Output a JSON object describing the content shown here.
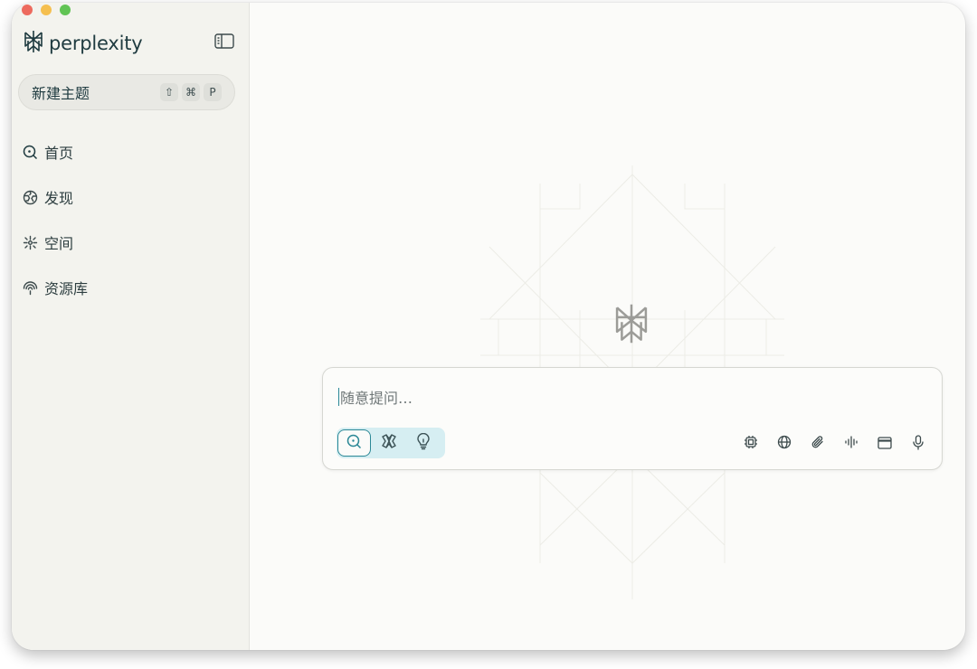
{
  "window": {
    "traffic_colors": [
      "#ed6a5e",
      "#f5bf4f",
      "#61c454"
    ]
  },
  "sidebar": {
    "brand": "perplexity",
    "collapse_icon": "sidebar-toggle-icon",
    "new_thread": {
      "label": "新建主题",
      "shortcut": [
        "⇧",
        "⌘",
        "P"
      ]
    },
    "items": [
      {
        "label": "首页",
        "icon": "search-home-icon"
      },
      {
        "label": "发现",
        "icon": "globe-icon"
      },
      {
        "label": "空间",
        "icon": "spaces-icon"
      },
      {
        "label": "资源库",
        "icon": "library-icon"
      }
    ]
  },
  "composer": {
    "placeholder": "随意提问…",
    "modes": [
      {
        "icon": "search-icon",
        "active": true
      },
      {
        "icon": "research-icon",
        "active": false
      },
      {
        "icon": "lightbulb-icon",
        "active": false
      }
    ],
    "tools": [
      "chip-icon",
      "globe-icon",
      "paperclip-icon",
      "waveform-icon",
      "browser-window-icon",
      "microphone-icon"
    ]
  },
  "colors": {
    "accent": "#2b8896",
    "brand_text": "#1f3b40",
    "sidebar_bg": "#f3f3ee",
    "main_bg": "#fbfbf9"
  }
}
